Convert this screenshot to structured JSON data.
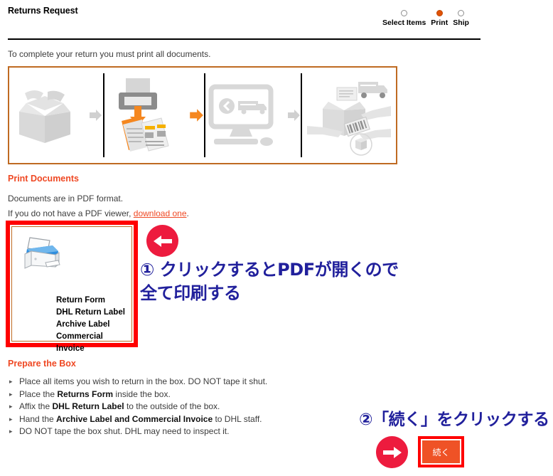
{
  "page": {
    "title": "Returns Request",
    "intro": "To complete your return you must print all documents."
  },
  "stepper": {
    "steps": [
      {
        "label": "Select Items",
        "active": false
      },
      {
        "label": "Print",
        "active": true
      },
      {
        "label": "Ship",
        "active": false
      }
    ]
  },
  "icon_strip": {
    "icons": [
      "open-box-icon",
      "arrow-right-icon",
      "printer-documents-icon",
      "arrow-right-orange-icon",
      "monitor-truck-icon",
      "arrow-right-icon",
      "handoff-parcel-icon"
    ]
  },
  "print_documents": {
    "heading": "Print Documents",
    "format_line": "Documents are in PDF format.",
    "viewer_line_prefix": "If you do not have a PDF viewer, ",
    "viewer_link": "download one",
    "viewer_line_suffix": ".",
    "box": {
      "icon": "printer-icon",
      "documents": [
        "Return Form",
        "DHL Return Label",
        "Archive Label",
        "Commercial Invoice"
      ]
    }
  },
  "prepare_box": {
    "heading": "Prepare the Box",
    "items": [
      {
        "pre": "Place all items you wish to return in the box. DO NOT tape it shut.",
        "bold": "",
        "post": ""
      },
      {
        "pre": "Place the ",
        "bold": "Returns Form",
        "post": " inside the box."
      },
      {
        "pre": "Affix the ",
        "bold": "DHL Return Label",
        "post": " to the outside of the box."
      },
      {
        "pre": "Hand the ",
        "bold": "Archive Label and Commercial Invoice",
        "post": " to DHL staff."
      },
      {
        "pre": "DO NOT tape the box shut. DHL may need to inspect it.",
        "bold": "",
        "post": ""
      }
    ]
  },
  "annotations": {
    "step1_text": "① クリックするとPDFが開くので\n全て印刷する",
    "step2_text": "②「続く」をクリックする",
    "arrow_left": "arrow-left-icon",
    "arrow_right": "arrow-right-icon"
  },
  "continue": {
    "label": "続く"
  },
  "colors": {
    "accent_orange": "#ef4823",
    "step_active": "#e05206",
    "strip_border": "#bf6a22",
    "highlight_red": "#ff0000",
    "anno_circle": "#ed1b3e",
    "anno_text": "#21209c",
    "button_orange": "#ef5226"
  }
}
